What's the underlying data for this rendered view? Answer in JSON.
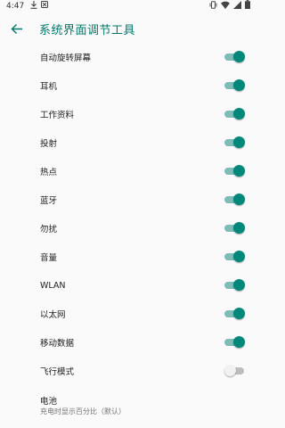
{
  "status_bar": {
    "time": "4:47",
    "notification_icons": [
      "download-icon",
      "blocked-icon"
    ],
    "system_icons": [
      "vibrate-icon",
      "wifi-icon",
      "signal-icon",
      "battery-icon"
    ]
  },
  "app_bar": {
    "title": "系统界面调节工具",
    "back_icon": "arrow-back-icon",
    "accent_color": "#00796b"
  },
  "items": [
    {
      "label": "自动旋转屏幕",
      "on": true
    },
    {
      "label": "耳机",
      "on": true
    },
    {
      "label": "工作资料",
      "on": true
    },
    {
      "label": "投射",
      "on": true
    },
    {
      "label": "热点",
      "on": true
    },
    {
      "label": "蓝牙",
      "on": true
    },
    {
      "label": "勿扰",
      "on": true
    },
    {
      "label": "音量",
      "on": true
    },
    {
      "label": "WLAN",
      "on": true
    },
    {
      "label": "以太网",
      "on": true
    },
    {
      "label": "移动数据",
      "on": true
    },
    {
      "label": "飞行模式",
      "on": false
    }
  ],
  "battery": {
    "title": "电池",
    "summary": "充电时显示百分比（默认）"
  },
  "colors": {
    "switch_on_thumb": "#00897b",
    "switch_on_track": "#7fbcb5",
    "switch_off_thumb": "#f1f1f1",
    "switch_off_track": "#bdbdbd"
  }
}
